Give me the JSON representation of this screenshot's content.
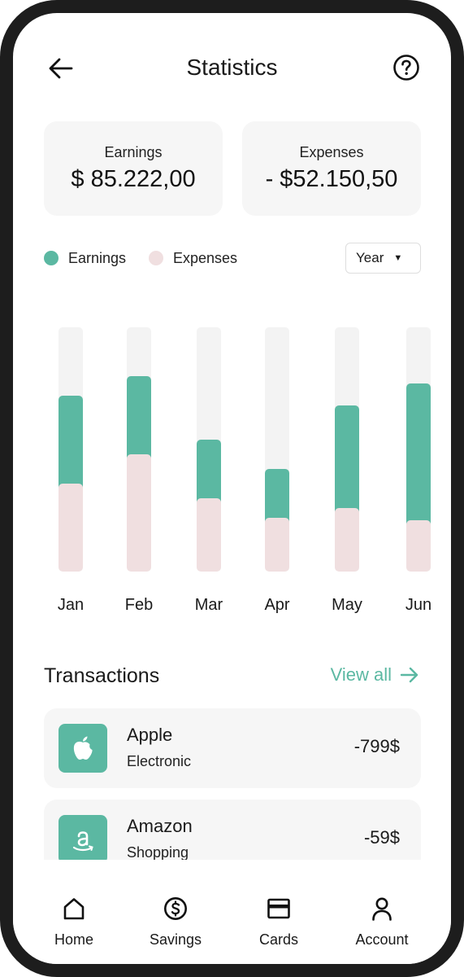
{
  "header": {
    "title": "Statistics"
  },
  "summary": {
    "earnings": {
      "label": "Earnings",
      "value": "$ 85.222,00"
    },
    "expenses": {
      "label": "Expenses",
      "value": "- $52.150,50"
    }
  },
  "legend": {
    "earnings": "Earnings",
    "expenses": "Expenses"
  },
  "period_select": {
    "value": "Year"
  },
  "colors": {
    "earnings": "#5bb8a2",
    "expenses": "#f0dfe0",
    "track": "#f3f3f3",
    "accent": "#5bb8a2"
  },
  "chart_data": {
    "type": "bar",
    "categories": [
      "Jan",
      "Feb",
      "Mar",
      "Apr",
      "May",
      "Jun"
    ],
    "series": [
      {
        "name": "Earnings",
        "values": [
          0.72,
          0.8,
          0.54,
          0.42,
          0.68,
          0.77
        ]
      },
      {
        "name": "Expenses",
        "values": [
          0.36,
          0.48,
          0.3,
          0.22,
          0.26,
          0.21
        ]
      }
    ],
    "ylim": [
      0,
      1
    ]
  },
  "transactions": {
    "title": "Transactions",
    "view_all": "View all",
    "items": [
      {
        "name": "Apple",
        "category": "Electronic",
        "amount": "-799$",
        "icon": "apple-icon"
      },
      {
        "name": "Amazon",
        "category": "Shopping",
        "amount": "-59$",
        "icon": "amazon-icon"
      }
    ]
  },
  "nav": {
    "items": [
      {
        "label": "Home",
        "icon": "home-icon"
      },
      {
        "label": "Savings",
        "icon": "dollar-circle-icon"
      },
      {
        "label": "Cards",
        "icon": "card-icon"
      },
      {
        "label": "Account",
        "icon": "user-icon"
      }
    ]
  }
}
